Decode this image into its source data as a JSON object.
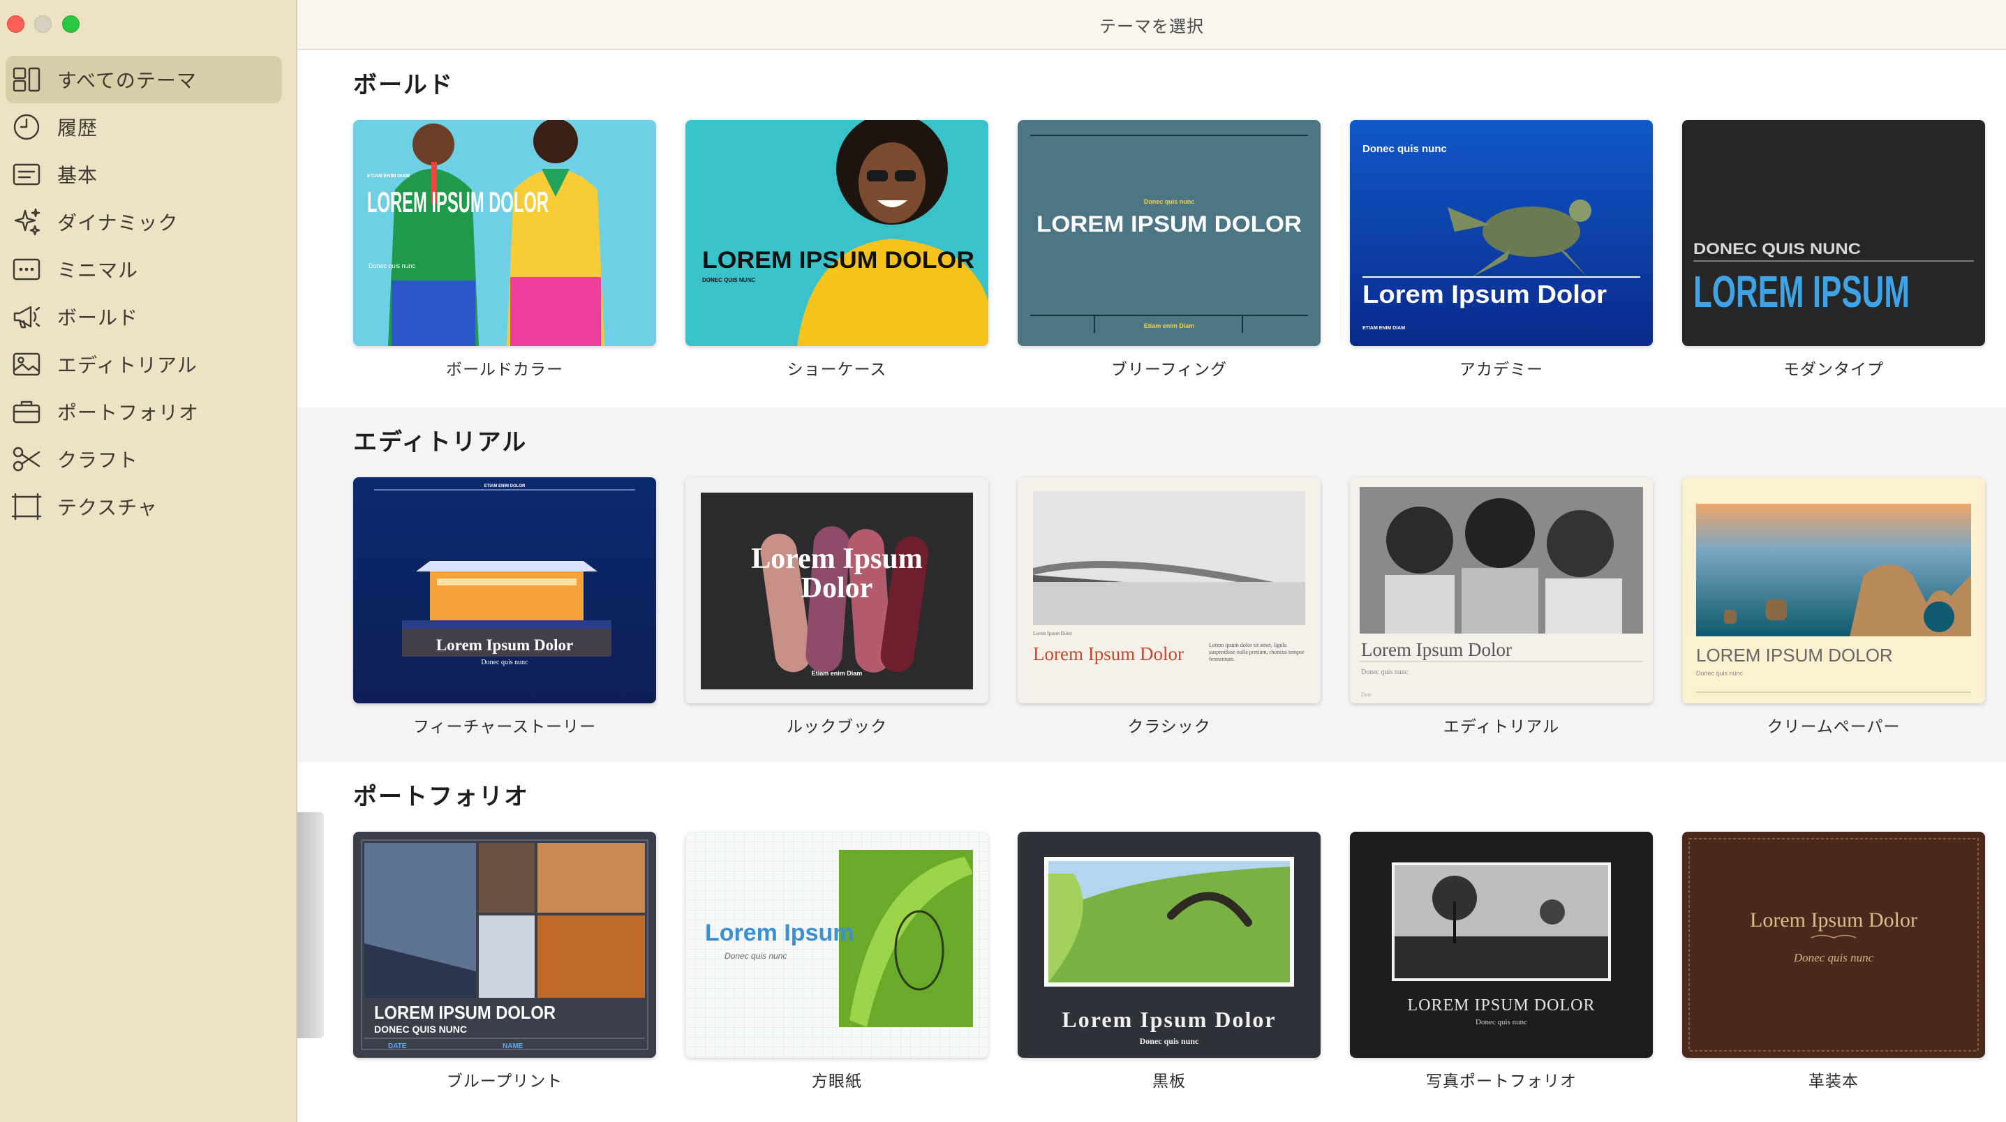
{
  "window": {
    "title": "テーマを選択"
  },
  "sidebar": {
    "items": [
      {
        "label": "すべてのテーマ",
        "icon": "grid-icon",
        "selected": true
      },
      {
        "label": "履歴",
        "icon": "clock-icon"
      },
      {
        "label": "基本",
        "icon": "text-box-icon"
      },
      {
        "label": "ダイナミック",
        "icon": "sparkles-icon"
      },
      {
        "label": "ミニマル",
        "icon": "ellipsis-box-icon"
      },
      {
        "label": "ボールド",
        "icon": "megaphone-icon"
      },
      {
        "label": "エディトリアル",
        "icon": "photo-icon"
      },
      {
        "label": "ポートフォリオ",
        "icon": "briefcase-icon"
      },
      {
        "label": "クラフト",
        "icon": "scissors-icon"
      },
      {
        "label": "テクスチャ",
        "icon": "texture-frame-icon"
      }
    ]
  },
  "sections": [
    {
      "title": "ボールド",
      "themes": [
        {
          "name": "ボールドカラー",
          "thumb_texts": [
            "ETIAM ENIM DIAM",
            "LOREM IPSUM DOLOR",
            "Donec quis nunc"
          ]
        },
        {
          "name": "ショーケース",
          "thumb_texts": [
            "LOREM IPSUM DOLOR",
            "DONEC QUIS NUNC"
          ]
        },
        {
          "name": "ブリーフィング",
          "thumb_texts": [
            "Donec quis nunc",
            "LOREM IPSUM DOLOR",
            "Etiam enim Diam"
          ]
        },
        {
          "name": "アカデミー",
          "thumb_texts": [
            "Donec quis nunc",
            "Lorem Ipsum Dolor",
            "ETIAM ENIM DIAM"
          ]
        },
        {
          "name": "モダンタイプ",
          "thumb_texts": [
            "DONEC QUIS NUNC",
            "LOREM IPSUM"
          ]
        }
      ]
    },
    {
      "title": "エディトリアル",
      "themes": [
        {
          "name": "フィーチャーストーリー",
          "thumb_texts": [
            "ETIAM ENIM DOLOR",
            "Lorem Ipsum Dolor",
            "Donec quis nunc"
          ]
        },
        {
          "name": "ルックブック",
          "thumb_texts": [
            "Lorem Ipsum",
            "Dolor",
            "Etiam enim Diam"
          ]
        },
        {
          "name": "クラシック",
          "thumb_texts": [
            "Lorem Ipsum Dolor",
            "Lorem Ipsum Dolor",
            "Lorem ipsum dolor sit amet, ligula suspendisse nulla pretium, rhoncus tempor fermentum."
          ]
        },
        {
          "name": "エディトリアル",
          "thumb_texts": [
            "Lorem Ipsum Dolor",
            "Donec quis nunc",
            "Date"
          ]
        },
        {
          "name": "クリームペーパー",
          "thumb_texts": [
            "LOREM IPSUM DOLOR",
            "Donec quis nunc"
          ]
        }
      ]
    },
    {
      "title": "ポートフォリオ",
      "themes": [
        {
          "name": "ブループリント",
          "thumb_texts": [
            "LOREM IPSUM DOLOR",
            "DONEC QUIS NUNC",
            "DATE",
            "NAME"
          ]
        },
        {
          "name": "方眼紙",
          "thumb_texts": [
            "Lorem Ipsum",
            "Donec quis nunc"
          ]
        },
        {
          "name": "黒板",
          "thumb_texts": [
            "Lorem Ipsum Dolor",
            "Donec quis nunc"
          ]
        },
        {
          "name": "写真ポートフォリオ",
          "thumb_texts": [
            "LOREM IPSUM DOLOR",
            "Donec quis nunc"
          ]
        },
        {
          "name": "革装本",
          "thumb_texts": [
            "Lorem Ipsum Dolor",
            "Donec quis nunc"
          ]
        }
      ]
    }
  ],
  "colors": {
    "sidebar_bg": "#ede3c4",
    "sidebar_selected": "#d9ceaa",
    "close": "#ff5f57",
    "maximize": "#28c840"
  }
}
